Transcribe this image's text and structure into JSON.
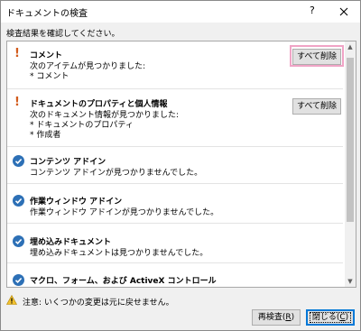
{
  "window": {
    "title": "ドキュメントの検査",
    "help_label": "?",
    "close_label": "×"
  },
  "instruction": "検査結果を確認してください。",
  "results": [
    {
      "status": "issue",
      "title": "コメント",
      "lines": [
        "次のアイテムが見つかりました:",
        "* コメント"
      ],
      "button": "すべて削除",
      "highlighted": true
    },
    {
      "status": "issue",
      "title": "ドキュメントのプロパティと個人情報",
      "lines": [
        "次のドキュメント情報が見つかりました:",
        "* ドキュメントのプロパティ",
        "* 作成者"
      ],
      "button": "すべて削除",
      "highlighted": false
    },
    {
      "status": "ok",
      "title": "コンテンツ アドイン",
      "lines": [
        "コンテンツ アドインが見つかりませんでした。"
      ]
    },
    {
      "status": "ok",
      "title": "作業ウィンドウ アドイン",
      "lines": [
        "作業ウィンドウ アドインが見つかりませんでした。"
      ]
    },
    {
      "status": "ok",
      "title": "埋め込みドキュメント",
      "lines": [
        "埋め込みドキュメントは見つかりませんでした。"
      ]
    },
    {
      "status": "ok",
      "title": "マクロ、フォーム、および ActiveX コントロール",
      "lines": []
    }
  ],
  "footer": {
    "warning": "注意: いくつかの変更は元に戻せません。",
    "recheck_label": "再検査(",
    "recheck_key": "R",
    "recheck_end": ")",
    "close_label": "閉じる(",
    "close_key": "C",
    "close_end": ")"
  },
  "colors": {
    "issue": "#d25b1c",
    "ok": "#2d70b6",
    "highlight": "#f0a4c6"
  }
}
